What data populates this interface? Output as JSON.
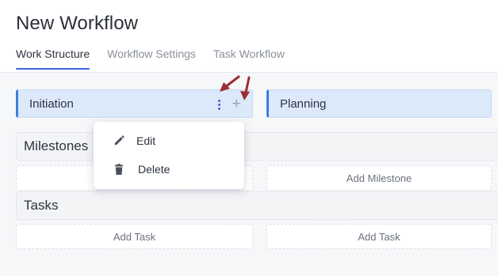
{
  "page": {
    "title": "New Workflow"
  },
  "tabs": [
    {
      "label": "Work Structure",
      "active": true
    },
    {
      "label": "Workflow Settings",
      "active": false
    },
    {
      "label": "Task Workflow",
      "active": false
    }
  ],
  "stages": [
    {
      "label": "Initiation",
      "icons": [
        "kebab-menu-icon",
        "plus-icon"
      ]
    },
    {
      "label": "Planning"
    }
  ],
  "sections": {
    "milestones": {
      "label": "Milestones",
      "add_label": "Add Milestone"
    },
    "tasks": {
      "label": "Tasks",
      "add_label": "Add Task"
    }
  },
  "context_menu": {
    "items": [
      {
        "label": "Edit",
        "icon": "pencil-icon"
      },
      {
        "label": "Delete",
        "icon": "trash-icon"
      }
    ]
  },
  "colors": {
    "accent": "#3f63d8",
    "stage_bg": "#dce9fb",
    "annotation_arrow": "#9b2c35"
  }
}
